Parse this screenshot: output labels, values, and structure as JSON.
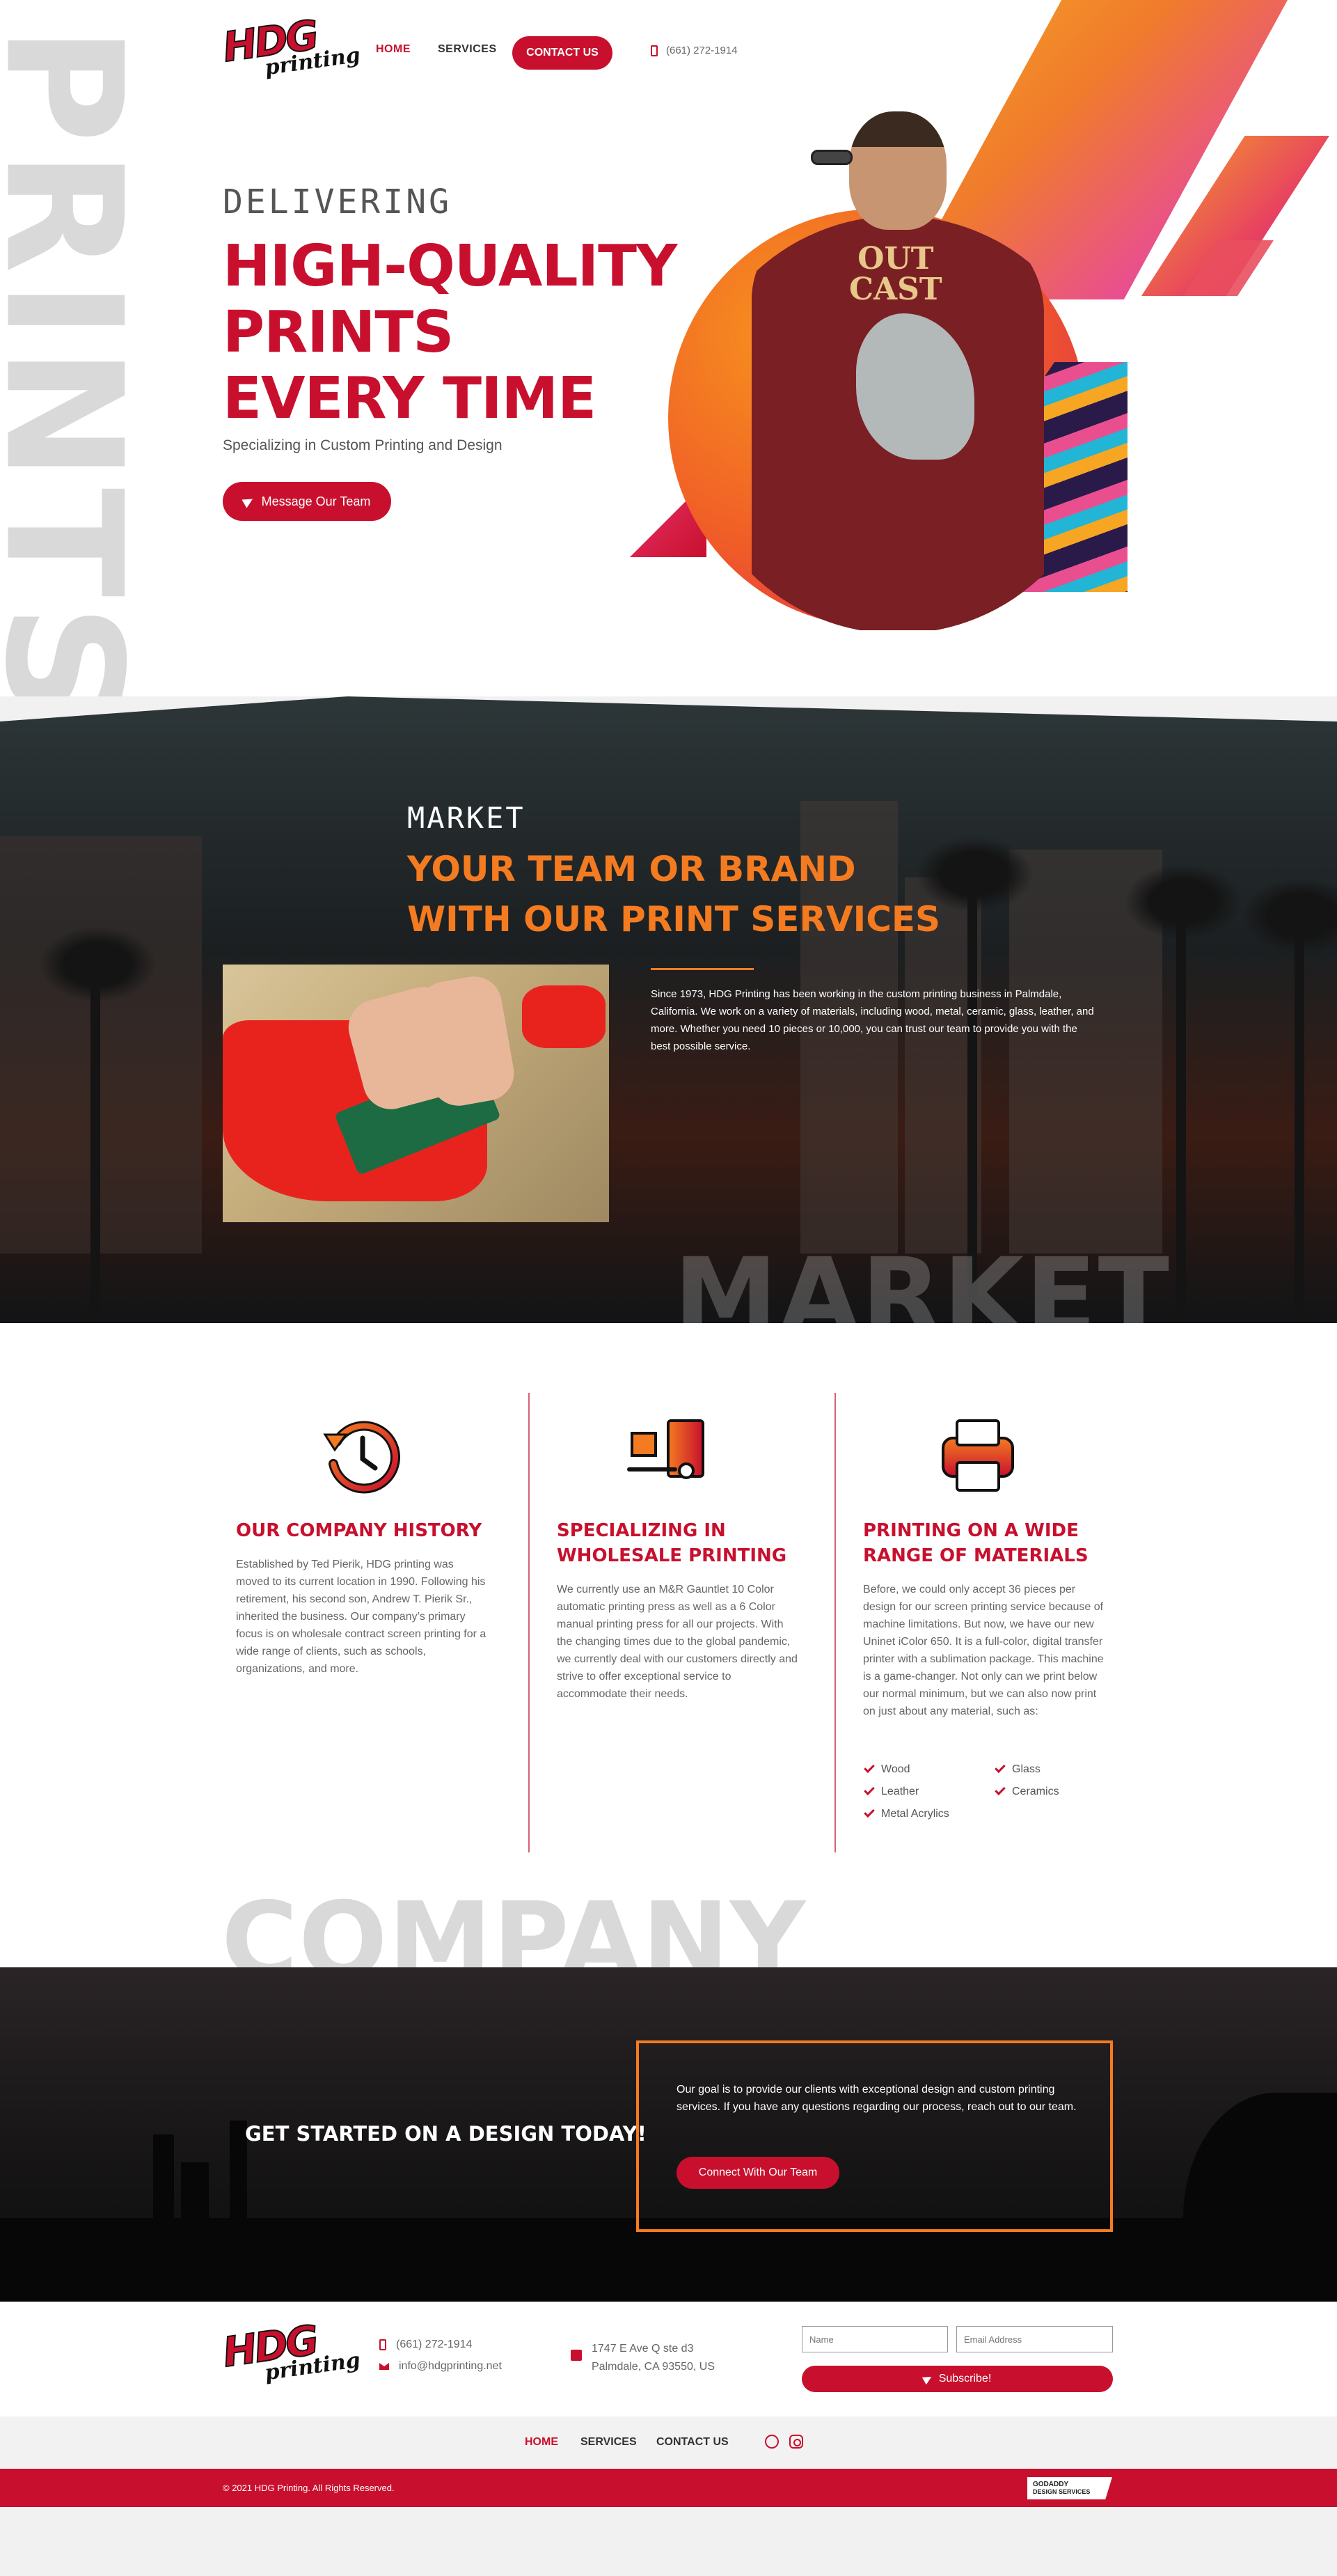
{
  "brand": {
    "logo_main": "HDG",
    "logo_sub": "printing",
    "primary_color": "#c8102e",
    "accent_color": "#f47b20"
  },
  "nav": {
    "items": [
      {
        "label": "HOME",
        "active": true
      },
      {
        "label": "SERVICES",
        "active": false
      }
    ],
    "cta_label": "CONTACT US",
    "phone": "(661) 272-1914",
    "phone_icon": "phone-icon"
  },
  "hero": {
    "background_word": "PRINTS",
    "kicker": "DELIVERING",
    "title_lines": [
      "HIGH-QUALITY",
      "PRINTS",
      "EVERY TIME"
    ],
    "subtitle": "Specializing in Custom Printing and Design",
    "button_label": "Message Our Team",
    "button_icon": "paper-plane-icon",
    "shirt_print": [
      "OUT",
      "CAST"
    ]
  },
  "market": {
    "kicker": "MARKET",
    "title_lines": [
      "YOUR TEAM OR BRAND",
      "WITH OUR PRINT SERVICES"
    ],
    "body": "Since 1973, HDG Printing has been working in the custom printing business in Palmdale, California. We work on a variety of materials, including wood, metal, ceramic, glass, leather, and more. Whether you need 10 pieces or 10,000, you can trust our team to provide you with the best possible service.",
    "ghost_word": "MARKET"
  },
  "features": [
    {
      "icon": "history-clock-icon",
      "title": "OUR COMPANY HISTORY",
      "body": "Established by Ted Pierik, HDG printing was moved to its current location in 1990. Following his retirement, his second son, Andrew T. Pierik Sr., inherited the business. Our company’s primary focus is on wholesale contract screen printing for a wide range of clients, such as schools, organizations, and more."
    },
    {
      "icon": "wholesale-pallet-icon",
      "title": "SPECIALIZING IN WHOLESALE PRINTING",
      "body": "We currently use an M&R Gauntlet 10 Color automatic printing press as well as a 6 Color manual printing press for all our projects. With the changing times due to the global pandemic, we currently deal with our customers directly and strive to offer exceptional service to accommodate their needs."
    },
    {
      "icon": "printer-icon",
      "title": "PRINTING ON A WIDE RANGE OF MATERIALS",
      "body": "Before, we could only accept 36 pieces per design for our screen printing service because of machine limitations. But now, we have our new Uninet iColor 650. It is a full-color, digital transfer printer with a sublimation package. This machine is a game-changer. Not only can we print below our normal minimum, but we can also now print on just about any material, such as:",
      "materials": [
        "Wood",
        "Glass",
        "Leather",
        "Ceramics",
        "Metal Acrylics"
      ]
    }
  ],
  "company_ghost": "COMPANY",
  "cta": {
    "title": "GET STARTED ON A DESIGN TODAY!",
    "body": "Our goal is to provide our clients with exceptional design and custom printing services. If you have any questions regarding our process, reach out to our team.",
    "button_label": "Connect With Our Team"
  },
  "footer": {
    "phone": "(661) 272-1914",
    "email": "info@hdgprinting.net",
    "address_line1": "1747 E Ave Q ste d3",
    "address_line2": "Palmdale, CA 93550, US",
    "name_placeholder": "Name",
    "email_placeholder": "Email Address",
    "subscribe_label": "Subscribe!",
    "nav": [
      "HOME",
      "SERVICES",
      "CONTACT US"
    ],
    "social": [
      "facebook-icon",
      "instagram-icon"
    ],
    "copyright": "© 2021 HDG Printing. All Rights Reserved.",
    "badge_line1": "GODADDY",
    "badge_line2": "DESIGN SERVICES"
  }
}
